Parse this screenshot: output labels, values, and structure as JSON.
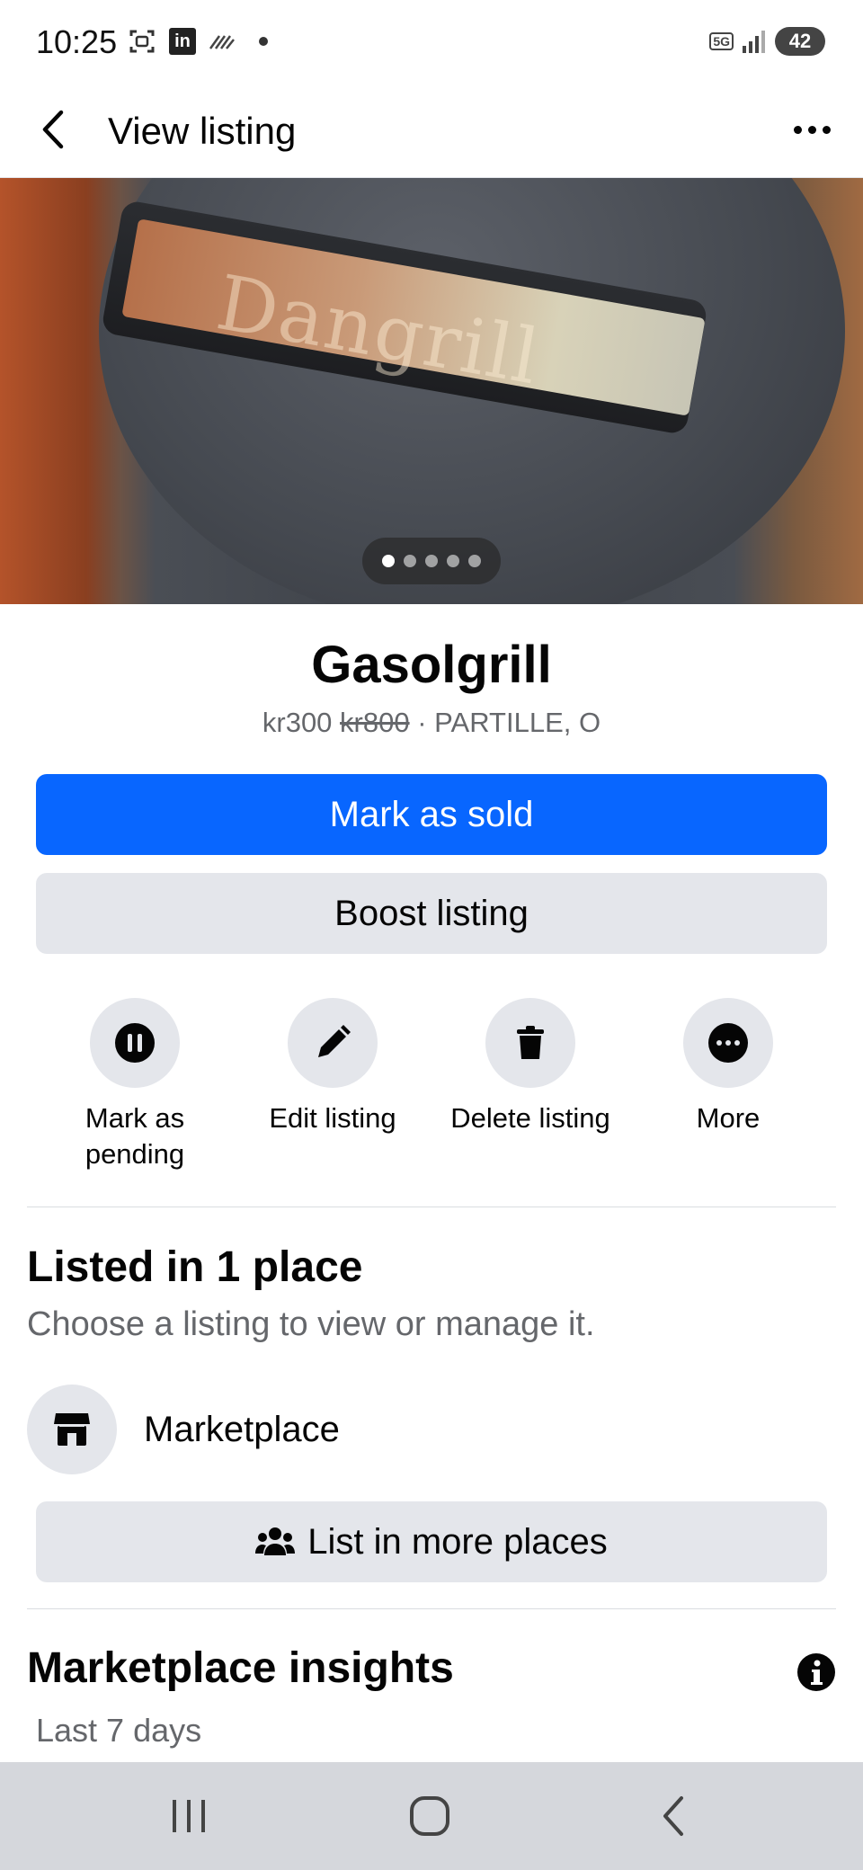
{
  "status_bar": {
    "time": "10:25",
    "network": "5G",
    "battery": "42"
  },
  "header": {
    "title": "View listing",
    "back_icon": "chevron-left-icon",
    "more_icon": "more-horizontal-icon"
  },
  "photo": {
    "brand_text": "Dangrill",
    "page_count": 5,
    "current_page": 1
  },
  "listing": {
    "title": "Gasolgrill",
    "price": "kr300",
    "original_price": "kr800",
    "separator": "·",
    "location": "PARTILLE, O"
  },
  "buttons": {
    "mark_sold": "Mark as sold",
    "boost": "Boost listing",
    "list_more": "List in more places"
  },
  "actions": [
    {
      "label": "Mark as pending",
      "icon": "pause-icon"
    },
    {
      "label": "Edit listing",
      "icon": "pencil-icon"
    },
    {
      "label": "Delete listing",
      "icon": "trash-icon"
    },
    {
      "label": "More",
      "icon": "more-circle-icon"
    }
  ],
  "listed_section": {
    "title": "Listed in 1 place",
    "subtitle": "Choose a listing to view or manage it.",
    "places": [
      {
        "label": "Marketplace",
        "icon": "storefront-icon"
      }
    ]
  },
  "insights": {
    "title": "Marketplace insights",
    "period": "Last 7 days",
    "icon": "info-icon"
  },
  "nav_bar": {
    "recents_icon": "recents-icon",
    "home_icon": "home-icon",
    "back_icon": "back-icon"
  },
  "colors": {
    "primary": "#0866ff",
    "secondary_bg": "#e4e6eb",
    "muted_text": "#65676b"
  }
}
